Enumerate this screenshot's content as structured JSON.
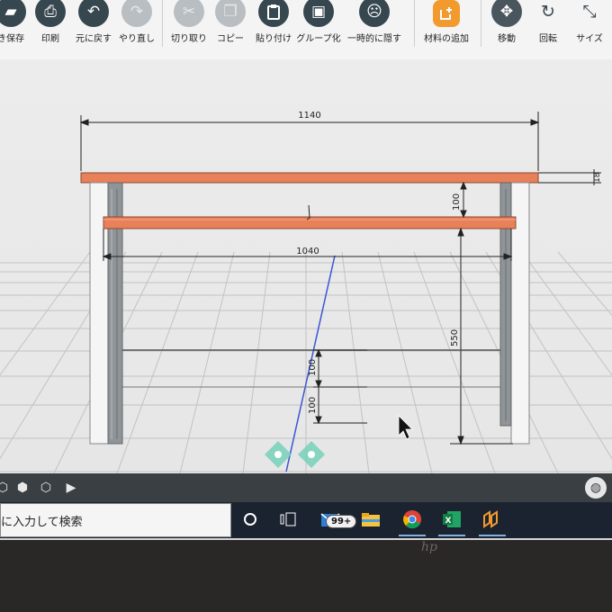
{
  "toolbar": {
    "items": [
      {
        "label": "き保存",
        "icon": "save-icon",
        "glyph": "▰",
        "state": "enabled"
      },
      {
        "label": "印刷",
        "icon": "print-icon",
        "glyph": "⎙",
        "state": "enabled"
      },
      {
        "label": "元に戻す",
        "icon": "undo-icon",
        "glyph": "↶",
        "state": "enabled"
      },
      {
        "label": "やり直し",
        "icon": "redo-icon",
        "glyph": "↷",
        "state": "disabled"
      },
      {
        "label": "切り取り",
        "icon": "cut-icon",
        "glyph": "✂",
        "state": "disabled"
      },
      {
        "label": "コピー",
        "icon": "copy-icon",
        "glyph": "❐",
        "state": "disabled"
      },
      {
        "label": "貼り付け",
        "icon": "paste-icon",
        "glyph": "📋",
        "state": "enabled"
      },
      {
        "label": "グループ化",
        "icon": "group-icon",
        "glyph": "▣",
        "state": "enabled"
      },
      {
        "label": "一時的に隠す",
        "icon": "hide-icon",
        "glyph": "☹",
        "state": "enabled"
      },
      {
        "label": "材料の追加",
        "icon": "add-material-icon",
        "glyph": "⊕",
        "state": "accent"
      },
      {
        "label": "移動",
        "icon": "move-icon",
        "glyph": "✥",
        "state": "enabled"
      },
      {
        "label": "回転",
        "icon": "rotate-icon",
        "glyph": "↻",
        "state": "plain"
      },
      {
        "label": "サイズ",
        "icon": "resize-icon",
        "glyph": "⤡",
        "state": "plain"
      }
    ]
  },
  "dimensions": {
    "total_width": "1140",
    "inner_width": "1040",
    "top_thickness": "18",
    "shelf_gap": "100",
    "shelf_height": "550",
    "lower_gap_1": "100",
    "lower_gap_2": "100"
  },
  "view_toolbar": {
    "icons": [
      "view-cube-icon",
      "view-front-icon",
      "view-iso-icon",
      "camera-icon"
    ],
    "globe_icon": "globe-icon"
  },
  "taskbar": {
    "search_placeholder": "に入力して検索",
    "apps": [
      "cortana-icon",
      "task-view-icon",
      "mail-icon",
      "file-explorer-icon",
      "chrome-icon",
      "excel-icon",
      "cad-app-icon"
    ],
    "mail_badge": "99+"
  },
  "colors": {
    "toolbar_icon": "#37474f",
    "accent": "#f29a2e",
    "board": "#e8805a",
    "taskbar": "#1b2330"
  }
}
